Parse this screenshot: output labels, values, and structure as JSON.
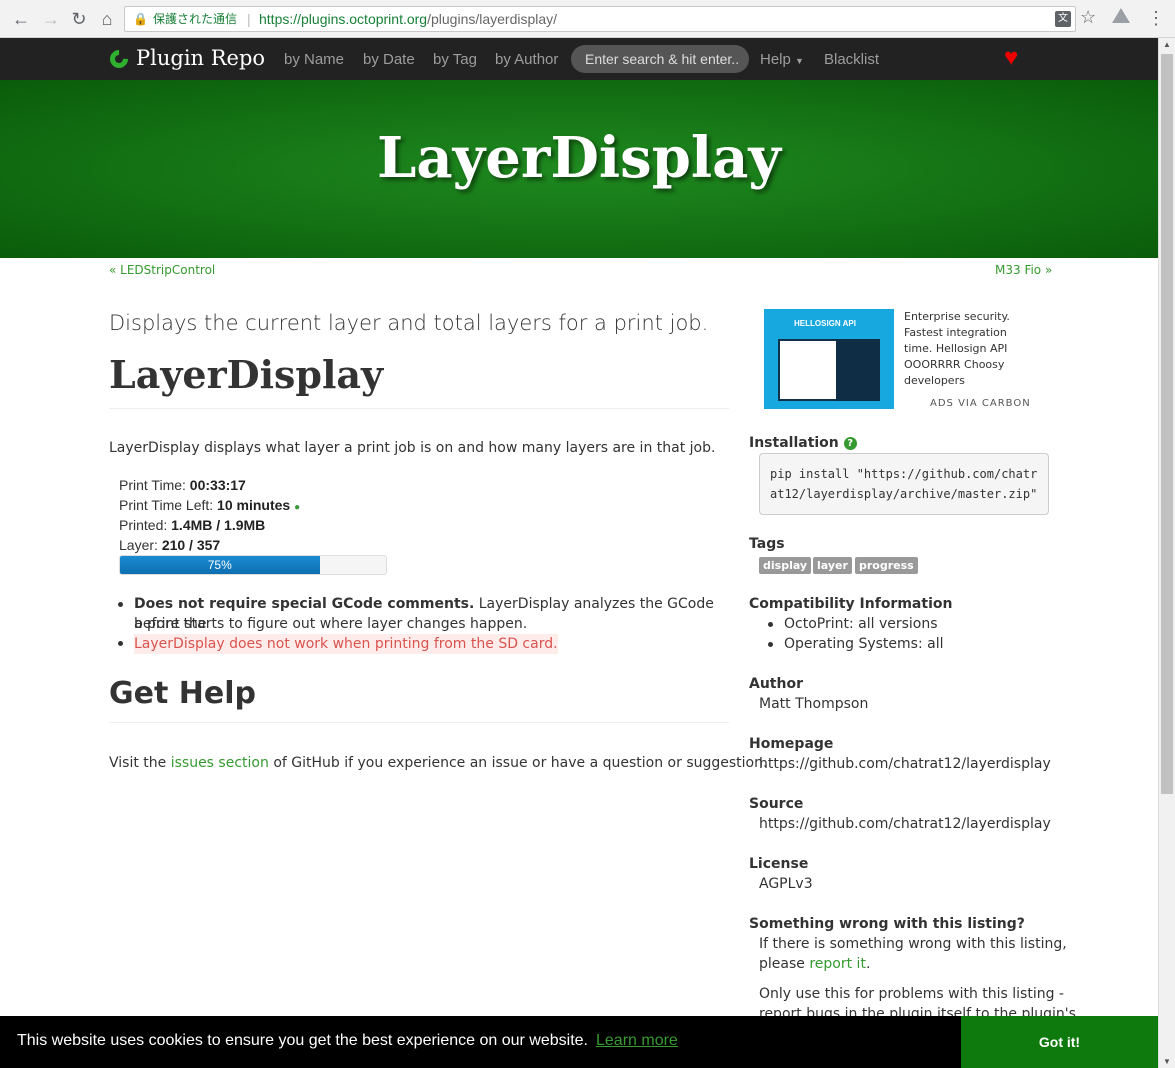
{
  "browser": {
    "secure_label": "保護された通信",
    "url_host": "https://plugins.octoprint.org",
    "url_path": "/plugins/layerdisplay/"
  },
  "navbar": {
    "brand": "Plugin Repo",
    "links": [
      "by Name",
      "by Date",
      "by Tag",
      "by Author"
    ],
    "search_placeholder": "Enter search & hit enter..",
    "help": "Help",
    "blacklist": "Blacklist"
  },
  "banner": {
    "title": "LayerDisplay"
  },
  "pager": {
    "prev": "« LEDStripControl",
    "next": "M33 Fio »"
  },
  "main": {
    "lead": "Displays the current layer and total layers for a print job.",
    "title": "LayerDisplay",
    "intro": "LayerDisplay displays what layer a print job is on and how many layers are in that job.",
    "stats": {
      "print_time_label": "Print Time:",
      "print_time": "00:33:17",
      "time_left_label": "Print Time Left:",
      "time_left": "10 minutes",
      "printed_label": "Printed:",
      "printed": "1.4MB / 1.9MB",
      "layer_label": "Layer:",
      "layer": "210 / 357",
      "progress_label": "75%",
      "progress_fraction": 0.75
    },
    "bullets": {
      "b1_bold": "Does not require special GCode comments.",
      "b1_line1": "LayerDisplay analyzes the GCode before the",
      "b1_line2": "a print starts to figure out where layer changes happen.",
      "b2": "LayerDisplay does not work when printing from the SD card."
    },
    "help_title": "Get Help",
    "help_pre": "Visit the",
    "help_link": "issues section",
    "help_post": "of GitHub if you experience an issue or have a question or suggestion."
  },
  "sidebar": {
    "ad_brand": "HELLOSIGN API",
    "ad_text": "Enterprise security. Fastest integration time.  Hellosign API OOORRRR Choosy developers",
    "ad_via": "ADS VIA CARBON",
    "installation_title": "Installation",
    "install_cmd": "pip install \"https://github.com/chatrat12/layerdisplay/archive/master.zip\"",
    "tags_title": "Tags",
    "tags": [
      "display",
      "layer",
      "progress"
    ],
    "compat_title": "Compatibility Information",
    "compat_octoprint": "OctoPrint: all versions",
    "compat_os": "Operating Systems: all",
    "author_title": "Author",
    "author": "Matt Thompson",
    "homepage_title": "Homepage",
    "homepage": "https://github.com/chatrat12/layerdisplay",
    "source_title": "Source",
    "source": "https://github.com/chatrat12/layerdisplay",
    "license_title": "License",
    "license": "AGPLv3",
    "wrong_title": "Something wrong with this listing?",
    "wrong_line1": "If there is something wrong with this listing,",
    "wrong_pre": "please",
    "wrong_link": "report it",
    "wrong_post": ".",
    "only_line1": "Only use this for problems with this listing -",
    "only_line2": "report bugs in the plugin itself to the plugin's"
  },
  "cookie": {
    "message": "This website uses cookies to ensure you get the best experience on our website.",
    "learn_more": "Learn more",
    "button": "Got it!"
  },
  "colors": {
    "accent": "#359a2f",
    "banner": "#0a5c0a",
    "cookie_button": "#0e7a0e"
  }
}
